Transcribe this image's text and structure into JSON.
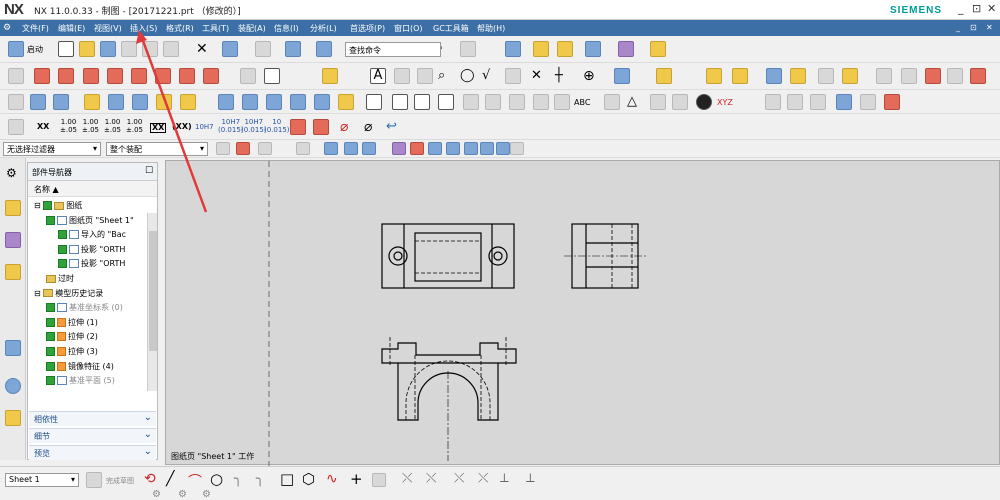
{
  "app": {
    "logo": "NX",
    "title": "NX 11.0.0.33 - 制图 - [20171221.prt （修改的）]",
    "brand": "SIEMENS",
    "window_controls": [
      "_",
      "⊡",
      "✕"
    ]
  },
  "menubar": {
    "items": [
      "文件(F)",
      "编辑(E)",
      "视图(V)",
      "插入(S)",
      "格式(R)",
      "工具(T)",
      "装配(A)",
      "信息(I)",
      "分析(L)",
      "首选项(P)",
      "窗口(O)",
      "GC工具箱",
      "帮助(H)"
    ],
    "right_controls": [
      "_",
      "⊡",
      "✕"
    ]
  },
  "toolbar": {
    "start_label": "启动",
    "search_placeholder": "查找命令",
    "precision_labels": [
      "XX",
      "1.00\n±.05",
      "1.00\n±.05",
      "1.00\n±.05",
      "1.00\n±.05",
      "XX",
      "(XX)",
      "10H7",
      "10H7\n(0.015)",
      "10H7\n(0.015)",
      "10\n(0.015)"
    ],
    "text_labels": [
      "A",
      "ABC",
      "XYZ"
    ]
  },
  "filters": {
    "selection_filter": "无选择过滤器",
    "scope": "整个装配"
  },
  "navigator": {
    "title": "部件导航器",
    "column": "名称",
    "tree": [
      {
        "label": "图纸",
        "indent": 0,
        "icon": "folder",
        "checked": true,
        "dim": false
      },
      {
        "label": "图纸页 \"Sheet 1\"",
        "indent": 1,
        "icon": "sheet",
        "checked": true,
        "dim": false
      },
      {
        "label": "导入的 \"Bac",
        "indent": 2,
        "icon": "import",
        "checked": true,
        "dim": false
      },
      {
        "label": "投影 \"ORTH",
        "indent": 2,
        "icon": "view",
        "checked": true,
        "dim": false
      },
      {
        "label": "投影 \"ORTH",
        "indent": 2,
        "icon": "view",
        "checked": true,
        "dim": false
      },
      {
        "label": "过时",
        "indent": 1,
        "icon": "folder",
        "checked": false,
        "dim": false
      },
      {
        "label": "模型历史记录",
        "indent": 0,
        "icon": "folder",
        "checked": false,
        "dim": false
      },
      {
        "label": "基准坐标系 (0)",
        "indent": 1,
        "icon": "datum",
        "checked": true,
        "dim": true
      },
      {
        "label": "拉伸 (1)",
        "indent": 1,
        "icon": "feature",
        "checked": true,
        "dim": false
      },
      {
        "label": "拉伸 (2)",
        "indent": 1,
        "icon": "feature",
        "checked": true,
        "dim": false
      },
      {
        "label": "拉伸 (3)",
        "indent": 1,
        "icon": "feature",
        "checked": true,
        "dim": false
      },
      {
        "label": "镜像特征 (4)",
        "indent": 1,
        "icon": "mirror",
        "checked": true,
        "dim": false
      },
      {
        "label": "基准平面 (5)",
        "indent": 1,
        "icon": "datum",
        "checked": true,
        "dim": true
      }
    ],
    "sections": [
      "相依性",
      "细节",
      "预览"
    ]
  },
  "canvas": {
    "status": "图纸页 \"Sheet 1\" 工作"
  },
  "bottom": {
    "sheet": "Sheet 1",
    "finish_label": "完成草图"
  },
  "colors": {
    "menubar": "#3b6fa5",
    "brand": "#009999",
    "canvas": "#d7d7d7",
    "annotation_arrow": "#e03a3a"
  }
}
